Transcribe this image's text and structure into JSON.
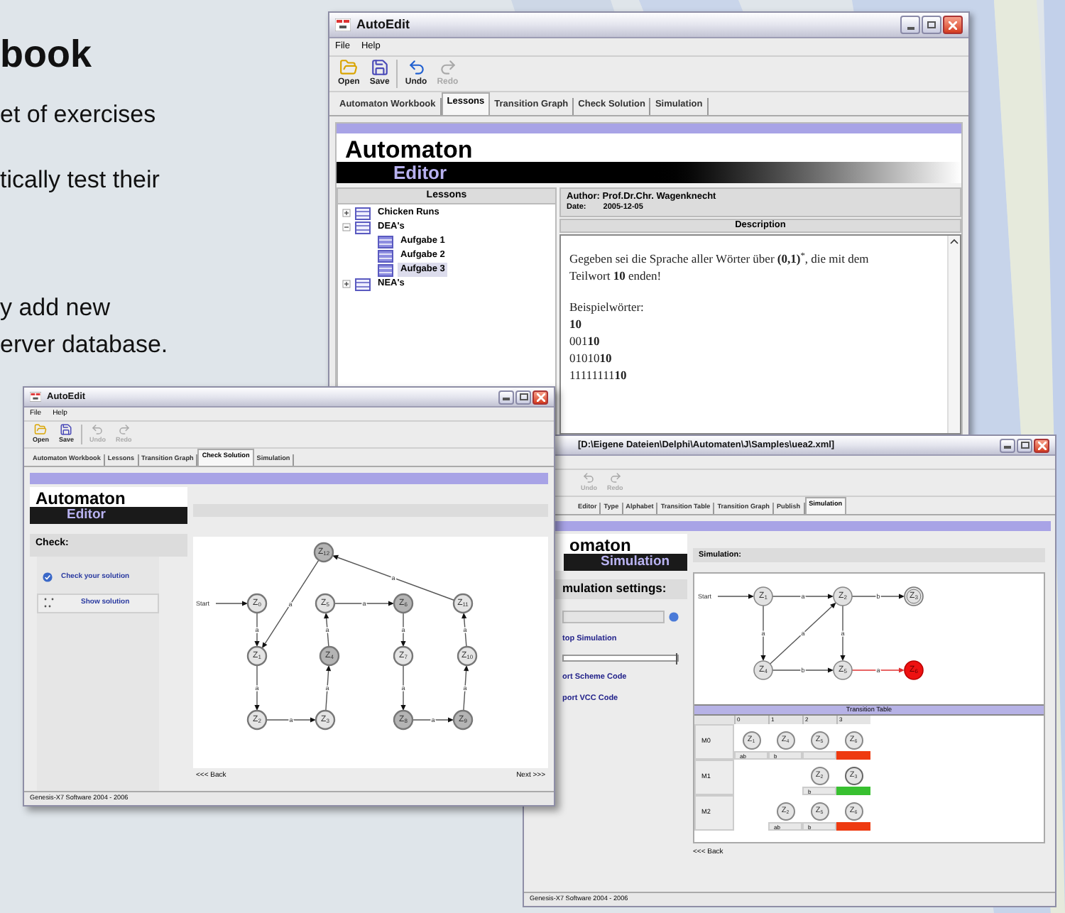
{
  "slide": {
    "heading": "book",
    "paragraphs": [
      [
        "et of exercises"
      ],
      [
        "tically test their"
      ],
      [
        "y add new",
        "erver database."
      ]
    ]
  },
  "lessons_window": {
    "title": "AutoEdit",
    "menu": [
      "File",
      "Help"
    ],
    "toolbar": [
      {
        "label": "Open",
        "kind": "open",
        "disabled": false
      },
      {
        "label": "Save",
        "kind": "save",
        "disabled": false
      },
      {
        "label": "Undo",
        "kind": "undo",
        "disabled": false
      },
      {
        "label": "Redo",
        "kind": "redo",
        "disabled": true
      }
    ],
    "tabs": [
      {
        "label": "Automaton Workbook",
        "selected": false
      },
      {
        "label": "Lessons",
        "selected": true
      },
      {
        "label": "Transition Graph",
        "selected": false
      },
      {
        "label": "Check Solution",
        "selected": false
      },
      {
        "label": "Simulation",
        "selected": false
      }
    ],
    "logo": {
      "top": "Automaton",
      "bottom": "Editor"
    },
    "lessons_header": "Lessons",
    "tree": [
      {
        "label": "Chicken Runs",
        "expanded": false,
        "selected": false
      },
      {
        "label": "DEA's",
        "expanded": true,
        "selected": false,
        "children": [
          {
            "label": "Aufgabe 1",
            "selected": false
          },
          {
            "label": "Aufgabe 2",
            "selected": false
          },
          {
            "label": "Aufgabe 3",
            "selected": true
          }
        ]
      },
      {
        "label": "NEA's",
        "expanded": false,
        "selected": false
      }
    ],
    "author": "Author: Prof.Dr.Chr. Wagenknecht",
    "date_label": "Date:",
    "date": "2005-12-05",
    "description_header": "Description",
    "description": [
      [
        "Gegeben sei die Sprache aller Wörter über **(0,1)**$^{*}$, die mit dem",
        "Teilwort **10** enden!"
      ],
      [
        "Beispielwörter:",
        "**10**",
        "001**10**",
        "01010**10**",
        "11111111**10**"
      ]
    ]
  },
  "simulation_window": {
    "title": "[D:\\Eigene Dateien\\Delphi\\Automaten\\J\\Samples\\uea2.xml]",
    "toolbar": [
      {
        "label": "Undo",
        "kind": "undo",
        "disabled": true
      },
      {
        "label": "Redo",
        "kind": "redo",
        "disabled": true
      }
    ],
    "tabs": [
      {
        "label": "Editor",
        "selected": false
      },
      {
        "label": "Type",
        "selected": false
      },
      {
        "label": "Alphabet",
        "selected": false
      },
      {
        "label": "Transition Table",
        "selected": false
      },
      {
        "label": "Transition Graph",
        "selected": false
      },
      {
        "label": "Publish",
        "selected": false
      },
      {
        "label": "Simulation",
        "selected": true
      }
    ],
    "logo": {
      "top": "omaton",
      "bottom": "Simulation"
    },
    "settings_header": "mulation settings:",
    "settings": [
      {
        "kind": "field"
      },
      {
        "kind": "link",
        "label": "top Simulation"
      },
      {
        "kind": "slider",
        "level": 1
      },
      {
        "kind": "link",
        "label": "ort Scheme Code"
      },
      {
        "kind": "link",
        "label": "port VCC Code"
      }
    ],
    "simulation_header": "Simulation:",
    "graph": {
      "start_label": "Start",
      "nodes": [
        {
          "label": "Z$_{1}$",
          "kind": "normal"
        },
        {
          "label": "Z$_{2}$",
          "kind": "normal"
        },
        {
          "label": "Z$_{3}$",
          "kind": "final"
        },
        {
          "label": "Z$_{4}$",
          "kind": "normal"
        },
        {
          "label": "Z$_{5}$",
          "kind": "normal"
        },
        {
          "label": "Z$_{6}$",
          "kind": "current"
        }
      ],
      "edges": [
        {
          "label": "a",
          "active": false
        },
        {
          "label": "b",
          "active": false
        },
        {
          "label": "a",
          "active": false
        },
        {
          "label": "a",
          "active": false
        },
        {
          "label": "a",
          "active": false
        },
        {
          "label": "b",
          "active": false
        },
        {
          "label": "a",
          "active": true
        }
      ]
    },
    "table": {
      "title": "Transition Table",
      "columns": [
        "0",
        "1",
        "2",
        "3"
      ],
      "rows": [
        {
          "label": "M0",
          "accepted": false,
          "cells": [
            {
              "kind": "step",
              "node": {
                "label": "Z$_{1}$",
                "final": false
              },
              "tag": "ab"
            },
            {
              "kind": "step",
              "node": {
                "label": "Z$_{4}$",
                "final": false
              },
              "tag": "b"
            },
            {
              "kind": "step",
              "node": {
                "label": "Z$_{5}$",
                "final": false
              }
            },
            {
              "kind": "result",
              "node": {
                "label": "Z$_{6}$",
                "final": false
              }
            }
          ]
        },
        {
          "label": "M1",
          "accepted": true,
          "cells": [
            {
              "kind": "empty"
            },
            {
              "kind": "empty"
            },
            {
              "kind": "step",
              "node": {
                "label": "Z$_{2}$",
                "final": false
              },
              "tag": "b"
            },
            {
              "kind": "result",
              "node": {
                "label": "Z$_{3}$",
                "final": true
              }
            }
          ]
        },
        {
          "label": "M2",
          "accepted": false,
          "cells": [
            {
              "kind": "empty"
            },
            {
              "kind": "step",
              "node": {
                "label": "Z$_{2}$",
                "final": false
              },
              "tag": "ab"
            },
            {
              "kind": "step",
              "node": {
                "label": "Z$_{5}$",
                "final": false
              },
              "tag": "b"
            },
            {
              "kind": "result",
              "node": {
                "label": "Z$_{6}$",
                "final": false
              }
            }
          ]
        }
      ]
    },
    "back": "<<< Back",
    "status": "Genesis-X7 Software 2004 - 2006"
  },
  "check_window": {
    "title": "AutoEdit",
    "menu": [
      "File",
      "Help"
    ],
    "toolbar": [
      {
        "label": "Open",
        "kind": "open",
        "disabled": false
      },
      {
        "label": "Save",
        "kind": "save",
        "disabled": false
      },
      {
        "label": "Undo",
        "kind": "undo",
        "disabled": true
      },
      {
        "label": "Redo",
        "kind": "redo",
        "disabled": true
      }
    ],
    "tabs": [
      {
        "label": "Automaton Workbook",
        "selected": false
      },
      {
        "label": "Lessons",
        "selected": false
      },
      {
        "label": "Transition Graph",
        "selected": false
      },
      {
        "label": "Check Solution",
        "selected": true
      },
      {
        "label": "Simulation",
        "selected": false
      }
    ],
    "logo": {
      "top": "Automaton",
      "bottom": "Editor"
    },
    "check_header": "Check:",
    "actions": [
      {
        "label": "Check your solution",
        "kind": "check"
      },
      {
        "label": "Show solution",
        "kind": "show"
      }
    ],
    "graph": {
      "start_label": "Start",
      "nodes": [
        {
          "label": "Z$_{12}$",
          "shaded": true
        },
        {
          "label": "Z$_{0}$",
          "shaded": false
        },
        {
          "label": "Z$_{5}$",
          "shaded": false
        },
        {
          "label": "Z$_{6}$",
          "shaded": true
        },
        {
          "label": "Z$_{11}$",
          "shaded": false
        },
        {
          "label": "Z$_{1}$",
          "shaded": false
        },
        {
          "label": "Z$_{4}$",
          "shaded": true
        },
        {
          "label": "Z$_{7}$",
          "shaded": false
        },
        {
          "label": "Z$_{10}$",
          "shaded": false
        },
        {
          "label": "Z$_{2}$",
          "shaded": false
        },
        {
          "label": "Z$_{3}$",
          "shaded": false
        },
        {
          "label": "Z$_{8}$",
          "shaded": true
        },
        {
          "label": "Z$_{9}$",
          "shaded": true
        }
      ],
      "edges": [
        {
          "label": "a"
        },
        {
          "label": "a"
        },
        {
          "label": "a"
        },
        {
          "label": "a"
        },
        {
          "label": "a"
        },
        {
          "label": "a"
        },
        {
          "label": "a"
        },
        {
          "label": "a"
        },
        {
          "label": "a"
        },
        {
          "label": "a"
        },
        {
          "label": "a"
        },
        {
          "label": "a"
        },
        {
          "label": "a"
        }
      ]
    },
    "back": "<<< Back",
    "next": "Next >>>",
    "status": "Genesis-X7 Software 2004 - 2006"
  }
}
